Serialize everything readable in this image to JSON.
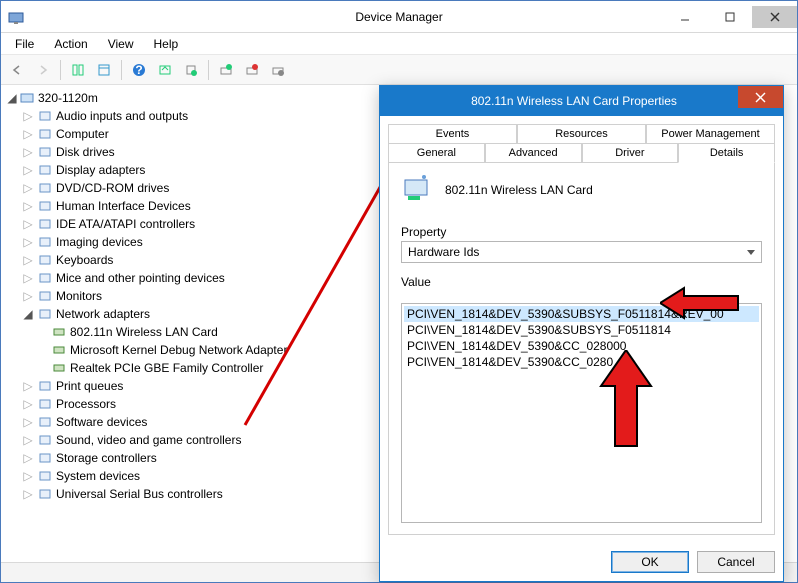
{
  "window": {
    "title": "Device Manager",
    "menus": [
      "File",
      "Action",
      "View",
      "Help"
    ]
  },
  "tree": {
    "root": "320-1120m",
    "nodes": [
      {
        "label": "Audio inputs and outputs",
        "expandable": true
      },
      {
        "label": "Computer",
        "expandable": true
      },
      {
        "label": "Disk drives",
        "expandable": true
      },
      {
        "label": "Display adapters",
        "expandable": true
      },
      {
        "label": "DVD/CD-ROM drives",
        "expandable": true
      },
      {
        "label": "Human Interface Devices",
        "expandable": true
      },
      {
        "label": "IDE ATA/ATAPI controllers",
        "expandable": true
      },
      {
        "label": "Imaging devices",
        "expandable": true
      },
      {
        "label": "Keyboards",
        "expandable": true
      },
      {
        "label": "Mice and other pointing devices",
        "expandable": true
      },
      {
        "label": "Monitors",
        "expandable": true
      },
      {
        "label": "Network adapters",
        "expandable": true,
        "expanded": true,
        "children": [
          {
            "label": "802.11n Wireless LAN Card"
          },
          {
            "label": "Microsoft Kernel Debug Network Adapter"
          },
          {
            "label": "Realtek PCIe GBE Family Controller"
          }
        ]
      },
      {
        "label": "Print queues",
        "expandable": true
      },
      {
        "label": "Processors",
        "expandable": true
      },
      {
        "label": "Software devices",
        "expandable": true
      },
      {
        "label": "Sound, video and game controllers",
        "expandable": true
      },
      {
        "label": "Storage controllers",
        "expandable": true
      },
      {
        "label": "System devices",
        "expandable": true
      },
      {
        "label": "Universal Serial Bus controllers",
        "expandable": true
      }
    ]
  },
  "dialog": {
    "title": "802.11n Wireless LAN Card Properties",
    "deviceName": "802.11n Wireless LAN Card",
    "tabsRow1": [
      "Events",
      "Resources",
      "Power Management"
    ],
    "tabsRow2": [
      "General",
      "Advanced",
      "Driver",
      "Details"
    ],
    "activeTab": "Details",
    "propertyLabel": "Property",
    "propertyValue": "Hardware Ids",
    "valueLabel": "Value",
    "values": [
      "PCI\\VEN_1814&DEV_5390&SUBSYS_F0511814&REV_00",
      "PCI\\VEN_1814&DEV_5390&SUBSYS_F0511814",
      "PCI\\VEN_1814&DEV_5390&CC_028000",
      "PCI\\VEN_1814&DEV_5390&CC_0280"
    ],
    "buttons": {
      "ok": "OK",
      "cancel": "Cancel"
    }
  }
}
